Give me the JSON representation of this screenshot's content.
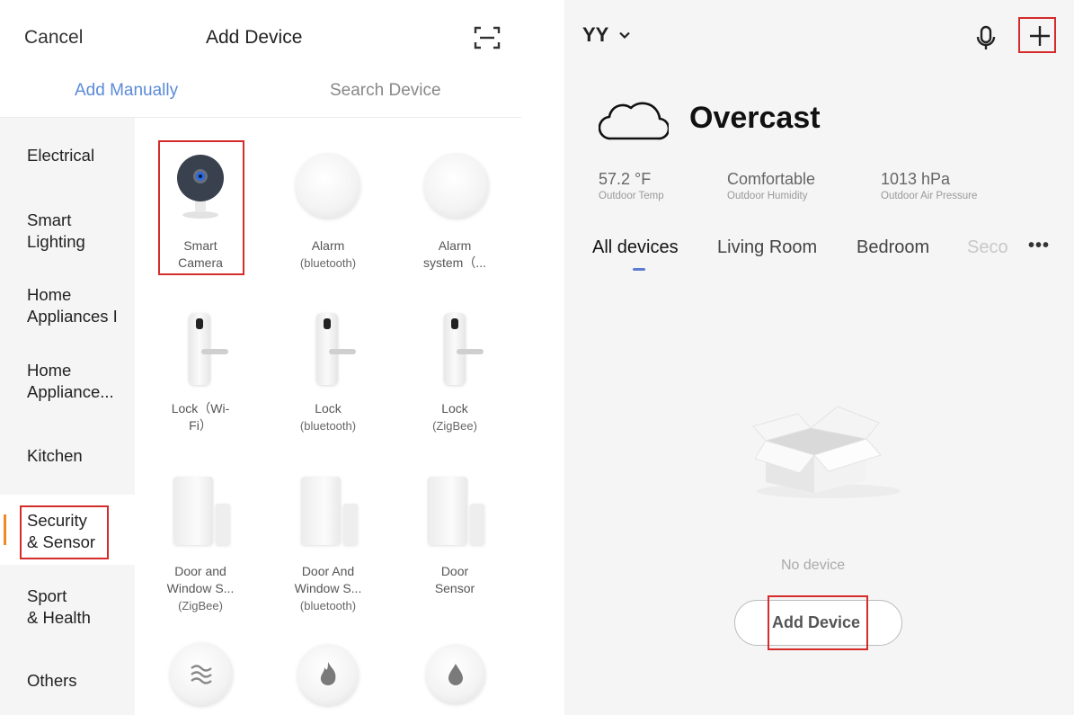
{
  "left": {
    "header": {
      "cancel": "Cancel",
      "title": "Add Device"
    },
    "tabs": {
      "manual": "Add Manually",
      "search": "Search Device"
    },
    "categories": [
      "Electrical",
      "Smart\nLighting",
      "Home\nAppliances I",
      "Home\nAppliance...",
      "Kitchen",
      "Security\n& Sensor",
      "Sport\n& Health",
      "Others"
    ],
    "selected_category": "Security & Sensor",
    "devices": [
      {
        "name": "Smart\nCamera",
        "sub": ""
      },
      {
        "name": "Alarm",
        "sub": "(bluetooth)"
      },
      {
        "name": "Alarm\nsystem（...",
        "sub": ""
      },
      {
        "name": "Lock（Wi-\nFi）",
        "sub": ""
      },
      {
        "name": "Lock",
        "sub": "(bluetooth)"
      },
      {
        "name": "Lock",
        "sub": "(ZigBee)"
      },
      {
        "name": "Door and\nWindow S...",
        "sub": "(ZigBee)"
      },
      {
        "name": "Door And\nWindow S...",
        "sub": "(bluetooth)"
      },
      {
        "name": "Door\nSensor",
        "sub": ""
      }
    ]
  },
  "right": {
    "home": "YY",
    "weather": "Overcast",
    "stats": [
      {
        "value": "57.2 °F",
        "label": "Outdoor Temp"
      },
      {
        "value": "Comfortable",
        "label": "Outdoor Humidity"
      },
      {
        "value": "1013 hPa",
        "label": "Outdoor Air Pressure"
      }
    ],
    "tabs": [
      "All devices",
      "Living Room",
      "Bedroom",
      "Seco"
    ],
    "more": "•••",
    "empty_text": "No device",
    "add_button": "Add Device"
  },
  "colors": {
    "accent_tab": "#5b8bd9",
    "highlight_box": "#d42b2b",
    "selected_bar": "#f08a24"
  }
}
